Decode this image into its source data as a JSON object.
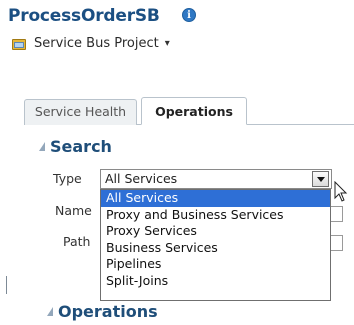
{
  "header": {
    "title": "ProcessOrderSB",
    "info_icon": "info-icon",
    "project_label": "Service Bus Project",
    "project_caret": "▾"
  },
  "tabs": [
    {
      "label": "Service Health",
      "selected": false
    },
    {
      "label": "Operations",
      "selected": true
    }
  ],
  "search": {
    "heading": "Search",
    "type_label": "Type",
    "type_value": "All Services",
    "name_label": "Name",
    "path_label": "Path",
    "dropdown_options": [
      "All Services",
      "Proxy and Business Services",
      "Proxy Services",
      "Business Services",
      "Pipelines",
      "Split-Joins"
    ],
    "selected_option_index": 0
  },
  "operations": {
    "heading": "Operations"
  },
  "colors": {
    "title": "#1b4f82",
    "section_heading": "#1f4e79",
    "selection": "#2e6fd6",
    "info_icon": "#2f78c4"
  }
}
